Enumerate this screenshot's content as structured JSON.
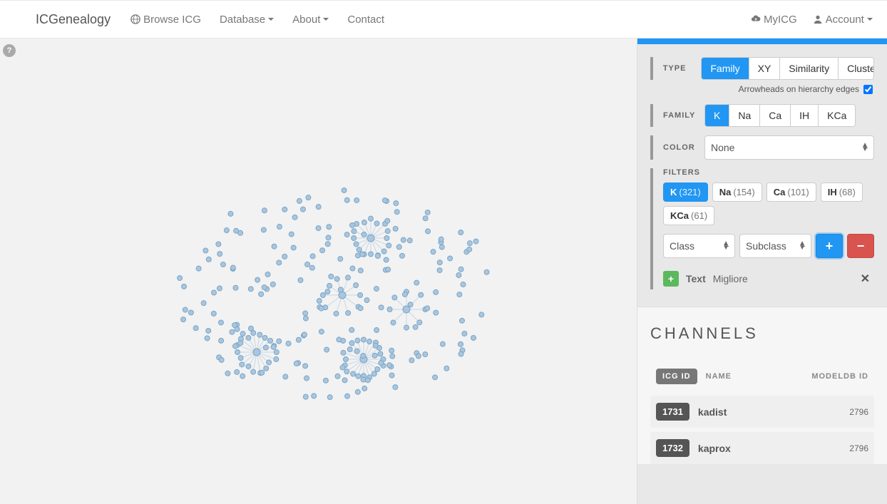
{
  "nav": {
    "brand": "ICGenealogy",
    "items": [
      "Browse ICG",
      "Database",
      "About",
      "Contact"
    ],
    "right": {
      "myicg": "MyICG",
      "account": "Account"
    }
  },
  "controls": {
    "type_label": "TYPE",
    "types": [
      "Family",
      "XY",
      "Similarity",
      "Cluster"
    ],
    "type_active": "Family",
    "arrowheads_label": "Arrowheads on hierarchy edges",
    "arrowheads_checked": true,
    "family_label": "FAMILY",
    "families": [
      "K",
      "Na",
      "Ca",
      "IH",
      "KCa"
    ],
    "family_active": "K",
    "color_label": "COLOR",
    "color_value": "None",
    "filters_label": "FILTERS",
    "filter_chips": [
      {
        "name": "K",
        "count": "(321)",
        "active": true
      },
      {
        "name": "Na",
        "count": "(154)",
        "active": false
      },
      {
        "name": "Ca",
        "count": "(101)",
        "active": false
      },
      {
        "name": "IH",
        "count": "(68)",
        "active": false
      },
      {
        "name": "KCa",
        "count": "(61)",
        "active": false
      }
    ],
    "class_select": "Class",
    "subclass_select": "Subclass",
    "text_filter": {
      "label": "Text",
      "value": "Migliore"
    }
  },
  "channels": {
    "title": "CHANNELS",
    "headers": {
      "icg": "ICG ID",
      "name": "NAME",
      "model": "MODELDB ID"
    },
    "rows": [
      {
        "icg": "1731",
        "name": "kadist",
        "model": "2796"
      },
      {
        "icg": "1732",
        "name": "kaprox",
        "model": "2796"
      }
    ]
  },
  "chart_data": {
    "type": "network",
    "note": "Force-directed genealogy graph of ion-channel models (K family). Several hub clusters with radiating spokes; ~300 nodes total. Exact coordinates are layout-derived, not data-bearing."
  }
}
